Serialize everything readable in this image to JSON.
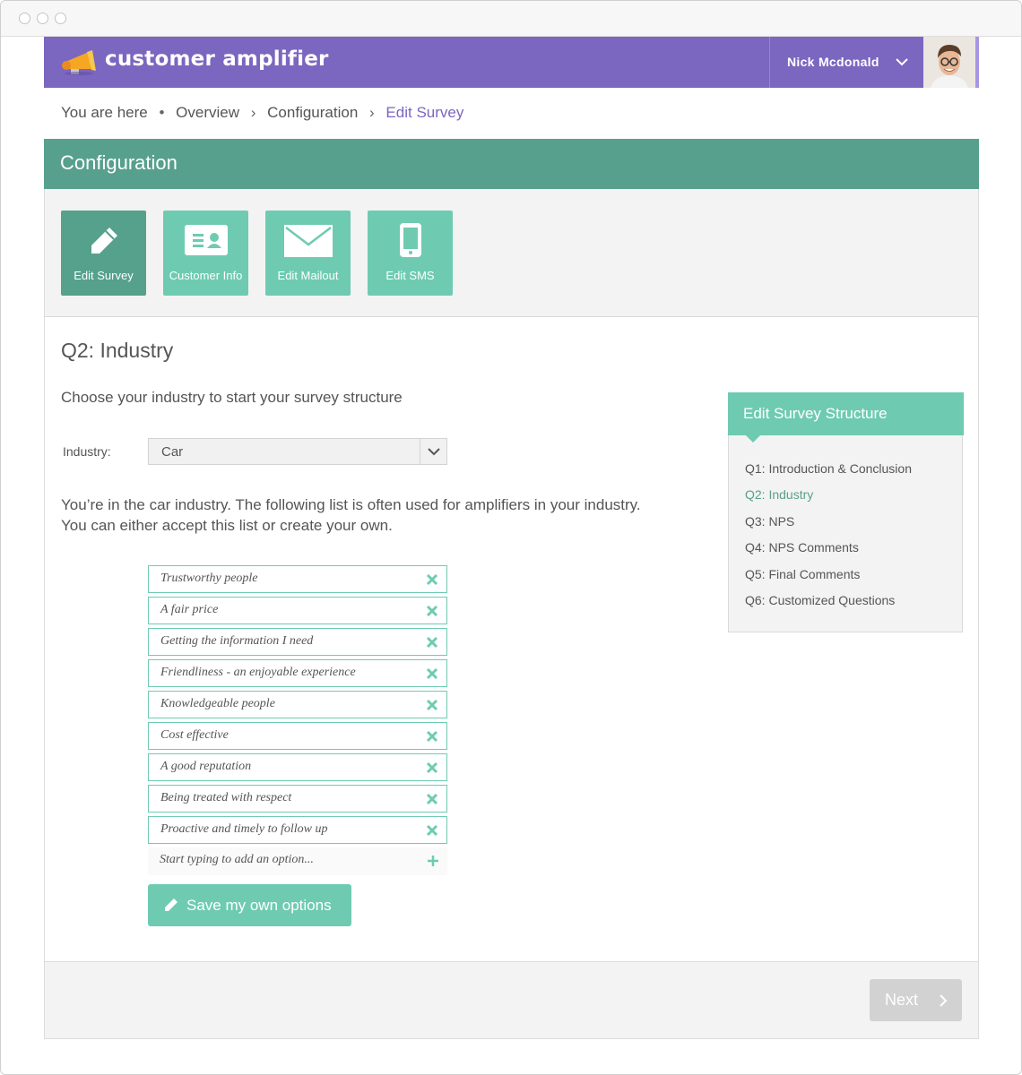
{
  "app": {
    "brand": "customer amplifier",
    "user_name": "Nick Mcdonald"
  },
  "breadcrumb": {
    "prefix": "You are here",
    "bullet": "•",
    "sep": "›",
    "items": [
      "Overview",
      "Configuration",
      "Edit Survey"
    ]
  },
  "config": {
    "title": "Configuration",
    "tools": [
      {
        "label": "Edit Survey",
        "icon": "pencil-icon",
        "active": true
      },
      {
        "label": "Customer Info",
        "icon": "id-card-icon",
        "active": false
      },
      {
        "label": "Edit Mailout",
        "icon": "envelope-icon",
        "active": false
      },
      {
        "label": "Edit SMS",
        "icon": "phone-icon",
        "active": false
      }
    ]
  },
  "question": {
    "title": "Q2: Industry",
    "intro": "Choose your industry to start your survey structure",
    "industry_label": "Industry:",
    "industry_value": "Car",
    "description_line1": "You’re in the car industry. The following list is often used for amplifiers in your industry.",
    "description_line2": "You can either accept this list or create your own.",
    "options": [
      "Trustworthy people",
      "A fair price",
      "Getting the information I need",
      "Friendliness - an enjoyable experience",
      "Knowledgeable people",
      "Cost effective",
      "A good reputation",
      "Being treated with respect",
      "Proactive and timely to follow up"
    ],
    "add_placeholder": "Start typing to add an option...",
    "save_label": "Save my own options"
  },
  "structure": {
    "title": "Edit Survey Structure",
    "items": [
      "Q1: Introduction & Conclusion",
      "Q2: Industry",
      "Q3: NPS",
      "Q4: NPS Comments",
      "Q5: Final Comments",
      "Q6: Customized Questions"
    ],
    "active_index": 1
  },
  "footer": {
    "next_label": "Next"
  },
  "colors": {
    "purple": "#7b66c0",
    "teal_dark": "#57a08d",
    "teal": "#6ecbb1",
    "gray": "#d2d2d2"
  }
}
